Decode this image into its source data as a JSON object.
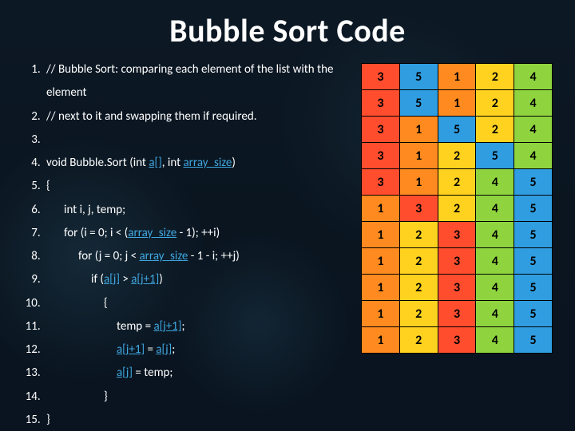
{
  "title": "Bubble Sort Code",
  "code": {
    "l1": "// Bubble Sort:  comparing each element of the list with the element",
    "l2": "// next to it and swapping them if required.",
    "l3": "",
    "l4a": "void Bubble.Sort (int ",
    "l4b": "a[]",
    "l4c": ", int ",
    "l4d": "array_size",
    "l4e": ")",
    "l5": "{",
    "l6": "int i, j, temp;",
    "l7a": "for (i = 0; i < (",
    "l7b": "array_size",
    "l7c": " - 1); ++i)",
    "l8a": "for (j = 0; j < ",
    "l8b": "array_size",
    "l8c": " - 1 - i; ++j)",
    "l9a": "if (",
    "l9b": "a[j]",
    "l9c": " > ",
    "l9d": "a[j+1]",
    "l9e": ")",
    "l10": "{",
    "l11a": "temp = ",
    "l11b": "a[j+1]",
    "l11c": ";",
    "l12a": "a[j+1]",
    "l12b": " = ",
    "l12c": "a[j]",
    "l12d": ";",
    "l13a": "a[j]",
    "l13b": " = temp;",
    "l14": "}",
    "l15": "}"
  },
  "table": {
    "rows": [
      [
        {
          "v": "3",
          "c": "c-red"
        },
        {
          "v": "5",
          "c": "c-blue"
        },
        {
          "v": "1",
          "c": "c-orange"
        },
        {
          "v": "2",
          "c": "c-yellow"
        },
        {
          "v": "4",
          "c": "c-green"
        }
      ],
      [
        {
          "v": "3",
          "c": "c-red"
        },
        {
          "v": "5",
          "c": "c-blue"
        },
        {
          "v": "1",
          "c": "c-orange"
        },
        {
          "v": "2",
          "c": "c-yellow"
        },
        {
          "v": "4",
          "c": "c-green"
        }
      ],
      [
        {
          "v": "3",
          "c": "c-red"
        },
        {
          "v": "1",
          "c": "c-orange"
        },
        {
          "v": "5",
          "c": "c-blue"
        },
        {
          "v": "2",
          "c": "c-yellow"
        },
        {
          "v": "4",
          "c": "c-green"
        }
      ],
      [
        {
          "v": "3",
          "c": "c-red"
        },
        {
          "v": "1",
          "c": "c-orange"
        },
        {
          "v": "2",
          "c": "c-yellow"
        },
        {
          "v": "5",
          "c": "c-blue"
        },
        {
          "v": "4",
          "c": "c-green"
        }
      ],
      [
        {
          "v": "3",
          "c": "c-red"
        },
        {
          "v": "1",
          "c": "c-orange"
        },
        {
          "v": "2",
          "c": "c-yellow"
        },
        {
          "v": "4",
          "c": "c-green"
        },
        {
          "v": "5",
          "c": "c-blue"
        }
      ],
      [
        {
          "v": "1",
          "c": "c-orange"
        },
        {
          "v": "3",
          "c": "c-red"
        },
        {
          "v": "2",
          "c": "c-yellow"
        },
        {
          "v": "4",
          "c": "c-green"
        },
        {
          "v": "5",
          "c": "c-blue"
        }
      ],
      [
        {
          "v": "1",
          "c": "c-orange"
        },
        {
          "v": "2",
          "c": "c-yellow"
        },
        {
          "v": "3",
          "c": "c-red"
        },
        {
          "v": "4",
          "c": "c-green"
        },
        {
          "v": "5",
          "c": "c-blue"
        }
      ],
      [
        {
          "v": "1",
          "c": "c-orange"
        },
        {
          "v": "2",
          "c": "c-yellow"
        },
        {
          "v": "3",
          "c": "c-red"
        },
        {
          "v": "4",
          "c": "c-green"
        },
        {
          "v": "5",
          "c": "c-blue"
        }
      ],
      [
        {
          "v": "1",
          "c": "c-orange"
        },
        {
          "v": "2",
          "c": "c-yellow"
        },
        {
          "v": "3",
          "c": "c-red"
        },
        {
          "v": "4",
          "c": "c-green"
        },
        {
          "v": "5",
          "c": "c-blue"
        }
      ],
      [
        {
          "v": "1",
          "c": "c-orange"
        },
        {
          "v": "2",
          "c": "c-yellow"
        },
        {
          "v": "3",
          "c": "c-red"
        },
        {
          "v": "4",
          "c": "c-green"
        },
        {
          "v": "5",
          "c": "c-blue"
        }
      ],
      [
        {
          "v": "1",
          "c": "c-orange"
        },
        {
          "v": "2",
          "c": "c-yellow"
        },
        {
          "v": "3",
          "c": "c-red"
        },
        {
          "v": "4",
          "c": "c-green"
        },
        {
          "v": "5",
          "c": "c-blue"
        }
      ]
    ]
  }
}
